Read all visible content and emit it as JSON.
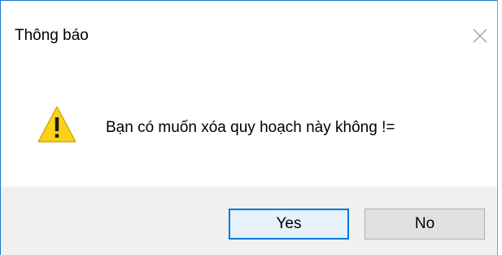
{
  "dialog": {
    "title": "Thông báo",
    "message": "Bạn có muốn xóa quy hoạch này không !=",
    "icon": "warning-icon",
    "close_icon": "close-icon"
  },
  "buttons": {
    "yes_label": "Yes",
    "no_label": "No",
    "default": "Yes"
  },
  "colors": {
    "accent": "#0078d7",
    "footer_bg": "#f0f0f0",
    "warning_fill": "#fcd116"
  }
}
